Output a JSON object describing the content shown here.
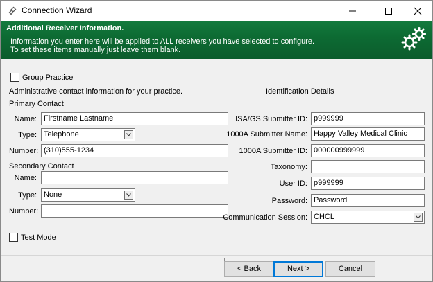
{
  "window": {
    "title": "Connection Wizard",
    "icon": "link-icon"
  },
  "header": {
    "title": "Additional Receiver Information.",
    "desc_line1": "Information you enter here will be applied to ALL receivers you have selected to configure.",
    "desc_line2": "To set these items manually just leave them blank.",
    "bg_color": "#0d6b33"
  },
  "group_practice": {
    "label": "Group Practice",
    "checked": false
  },
  "admin_note": "Administrative contact information for your practice.",
  "primary": {
    "heading": "Primary Contact",
    "name_label": "Name:",
    "name_value": "Firstname Lastname",
    "type_label": "Type:",
    "type_value": "Telephone",
    "number_label": "Number:",
    "number_value": "(310)555-1234"
  },
  "secondary": {
    "heading": "Secondary Contact",
    "name_label": "Name:",
    "name_value": "",
    "type_label": "Type:",
    "type_value": "None",
    "number_label": "Number:",
    "number_value": ""
  },
  "test_mode": {
    "label": "Test Mode",
    "checked": false
  },
  "identification": {
    "heading": "Identification Details",
    "isa_label": "ISA/GS Submitter ID:",
    "isa_value": "p999999",
    "name1000a_label": "1000A Submitter Name:",
    "name1000a_value": "Happy Valley Medical Clinic",
    "id1000a_label": "1000A Submitter ID:",
    "id1000a_value": "000000999999",
    "taxonomy_label": "Taxonomy:",
    "taxonomy_value": "",
    "userid_label": "User ID:",
    "userid_value": "p999999",
    "password_label": "Password:",
    "password_value": "Password",
    "session_label": "Communication Session:",
    "session_value": "CHCL"
  },
  "buttons": {
    "back": "< Back",
    "next": "Next >",
    "cancel": "Cancel"
  }
}
